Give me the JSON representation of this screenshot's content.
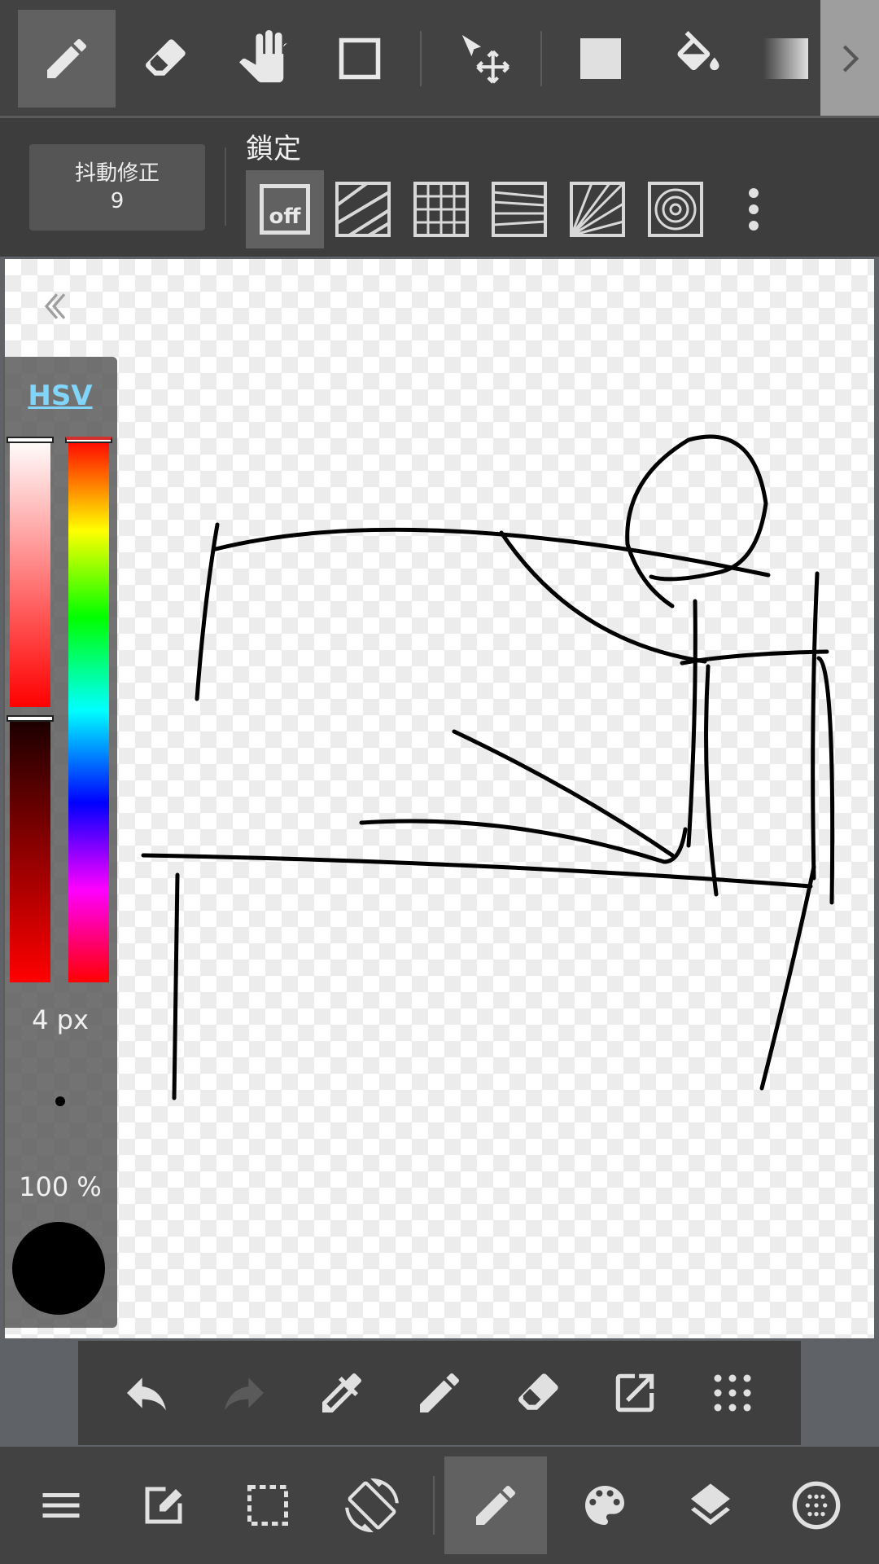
{
  "toolbar": {
    "tools": [
      {
        "icon": "pen-icon",
        "active": true
      },
      {
        "icon": "eraser-icon",
        "active": false
      },
      {
        "icon": "hand-icon",
        "active": false
      },
      {
        "icon": "rectangle-tool-icon",
        "active": false
      },
      {
        "icon": "move-transform-icon",
        "active": false
      },
      {
        "icon": "fill-square-icon",
        "active": false
      },
      {
        "icon": "bucket-icon",
        "active": false
      },
      {
        "icon": "gradient-icon",
        "active": false
      }
    ],
    "next_icon": "chevron-right-icon"
  },
  "settings": {
    "stabilizer_label": "抖動修正",
    "stabilizer_value": "9",
    "lock_label": "鎖定",
    "snap_off_label": "off",
    "snaps": [
      "off",
      "parallel",
      "grid",
      "perspective",
      "radial",
      "concentric"
    ],
    "more_icon": "more-vert-icon"
  },
  "color_panel": {
    "mode_label": "HSV",
    "brush_size": "4 px",
    "opacity": "100 %",
    "current_color": "#000000",
    "hue_color": "#ff0000"
  },
  "action_bar": {
    "buttons": [
      "undo-icon",
      "redo-icon",
      "eyedropper-icon",
      "pen-icon",
      "eraser-icon",
      "export-icon",
      "grid-menu-icon"
    ]
  },
  "nav_bar": {
    "buttons": [
      "menu-icon",
      "edit-icon",
      "selection-icon",
      "rotate-screen-icon",
      "brush-icon",
      "palette-icon",
      "layers-icon",
      "material-icon"
    ],
    "active": "brush-icon"
  },
  "colors": {
    "toolbar_bg": "#424242",
    "active_tool_bg": "#616161",
    "hsv_link": "#81d4fa",
    "stroke": "#000000"
  }
}
